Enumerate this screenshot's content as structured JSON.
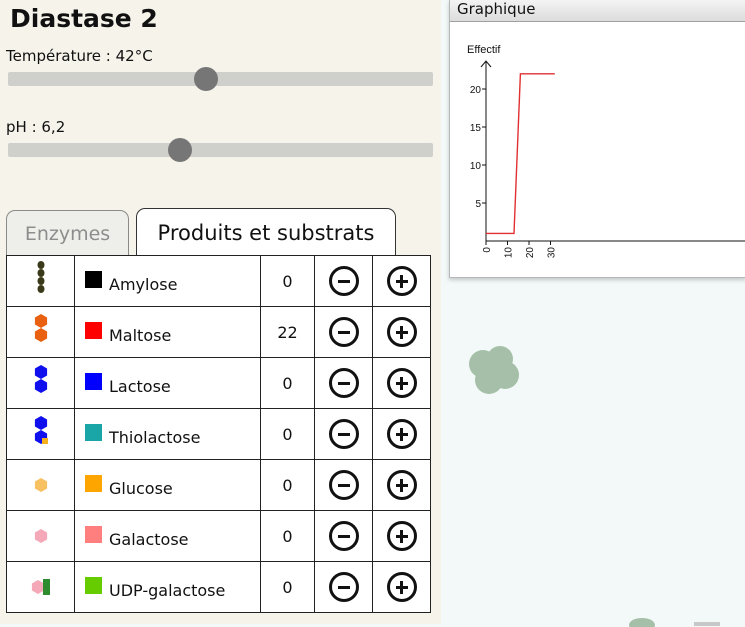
{
  "app": {
    "title": "Diastase 2"
  },
  "sliders": {
    "temperature": {
      "label": "Température : 42°C",
      "value": 0.465
    },
    "ph": {
      "label": "pH : 6,2",
      "value": 0.405
    }
  },
  "tabs": [
    {
      "label": "Enzymes",
      "active": false
    },
    {
      "label": "Produits et substrats",
      "active": true
    }
  ],
  "molecules": [
    {
      "name": "Amylose",
      "count": "0",
      "color": "#000000",
      "icon": "chain-icon"
    },
    {
      "name": "Maltose",
      "count": "22",
      "color": "#ff0000",
      "icon": "hexagon-pair-icon"
    },
    {
      "name": "Lactose",
      "count": "0",
      "color": "#0000ff",
      "icon": "hexagon-pair-icon"
    },
    {
      "name": "Thiolactose",
      "count": "0",
      "color": "#1aa6a6",
      "icon": "hexagon-pair-icon"
    },
    {
      "name": "Glucose",
      "count": "0",
      "color": "#ffa500",
      "icon": "hexagon-icon"
    },
    {
      "name": "Galactose",
      "count": "0",
      "color": "#ff7f7f",
      "icon": "hexagon-icon"
    },
    {
      "name": "UDP-galactose",
      "count": "0",
      "color": "#66cc00",
      "icon": "hexagon-udp-icon"
    }
  ],
  "graph_window": {
    "title": "Graphique",
    "chart_data": {
      "type": "line",
      "ylabel": "Effectif",
      "xlabel": "",
      "xticks": [
        "0",
        "10",
        "20",
        "30"
      ],
      "yticks": [
        "5",
        "10",
        "15",
        "20"
      ],
      "xlim": [
        0,
        30
      ],
      "ylim": [
        0,
        25
      ],
      "series": [
        {
          "color": "#e03030",
          "x": [
            0,
            13,
            16,
            32
          ],
          "y": [
            1,
            1,
            22,
            22
          ]
        }
      ]
    }
  }
}
